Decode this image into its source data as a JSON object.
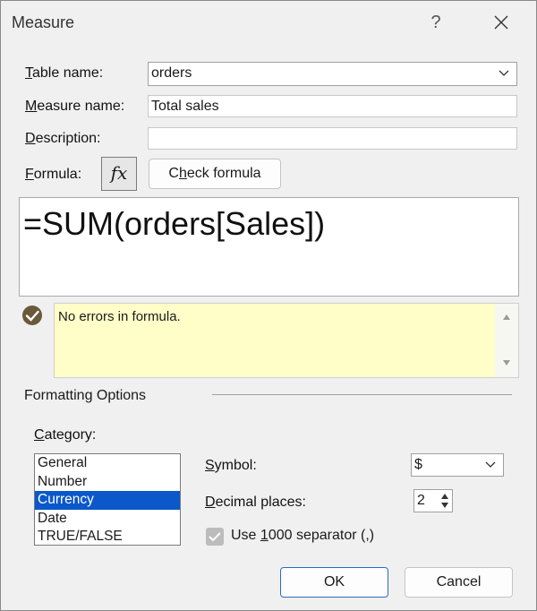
{
  "window": {
    "title": "Measure",
    "help_label": "?"
  },
  "table_name": {
    "label": "Table name:",
    "value": "orders"
  },
  "measure_name": {
    "label": "Measure name:",
    "value": "Total sales"
  },
  "description": {
    "label": "Description:",
    "value": ""
  },
  "formula": {
    "label": "Formula:",
    "fx_label": "fx",
    "check_button": "Check formula",
    "text": "=SUM(orders[Sales])",
    "status": "No errors in formula."
  },
  "formatting": {
    "title": "Formatting Options",
    "category_label": "Category:",
    "categories": [
      "General",
      "Number",
      "Currency",
      "Date",
      "TRUE/FALSE"
    ],
    "selected_category": "Currency",
    "symbol_label": "Symbol:",
    "symbol_value": "$",
    "decimal_label": "Decimal places:",
    "decimal_value": "2",
    "separator_label": "Use 1000 separator (,)",
    "separator_checked": true
  },
  "buttons": {
    "ok": "OK",
    "cancel": "Cancel"
  },
  "colors": {
    "selection": "#0a58c9",
    "status_bg": "#fffec8",
    "primary_border": "#2a6cc4"
  }
}
